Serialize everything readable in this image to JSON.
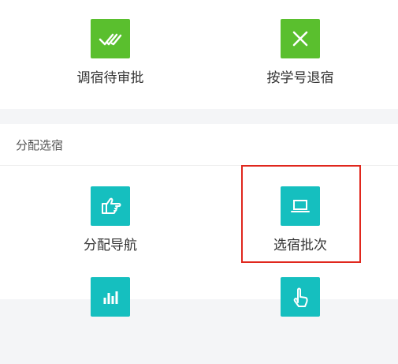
{
  "top_section": {
    "tiles": [
      {
        "label": "调宿待审批",
        "icon": "double-check-icon",
        "color": "#5abf2e"
      },
      {
        "label": "按学号退宿",
        "icon": "close-icon",
        "color": "#5abf2e"
      }
    ]
  },
  "assign_section": {
    "title": "分配选宿",
    "tiles": [
      {
        "label": "分配导航",
        "icon": "pointing-hand-icon",
        "color": "#15bfbf"
      },
      {
        "label": "选宿批次",
        "icon": "laptop-icon",
        "color": "#15bfbf"
      },
      {
        "label": "",
        "icon": "bar-chart-icon",
        "color": "#15bfbf"
      },
      {
        "label": "",
        "icon": "tap-hand-icon",
        "color": "#15bfbf"
      }
    ]
  },
  "highlight_color": "#e0271d"
}
